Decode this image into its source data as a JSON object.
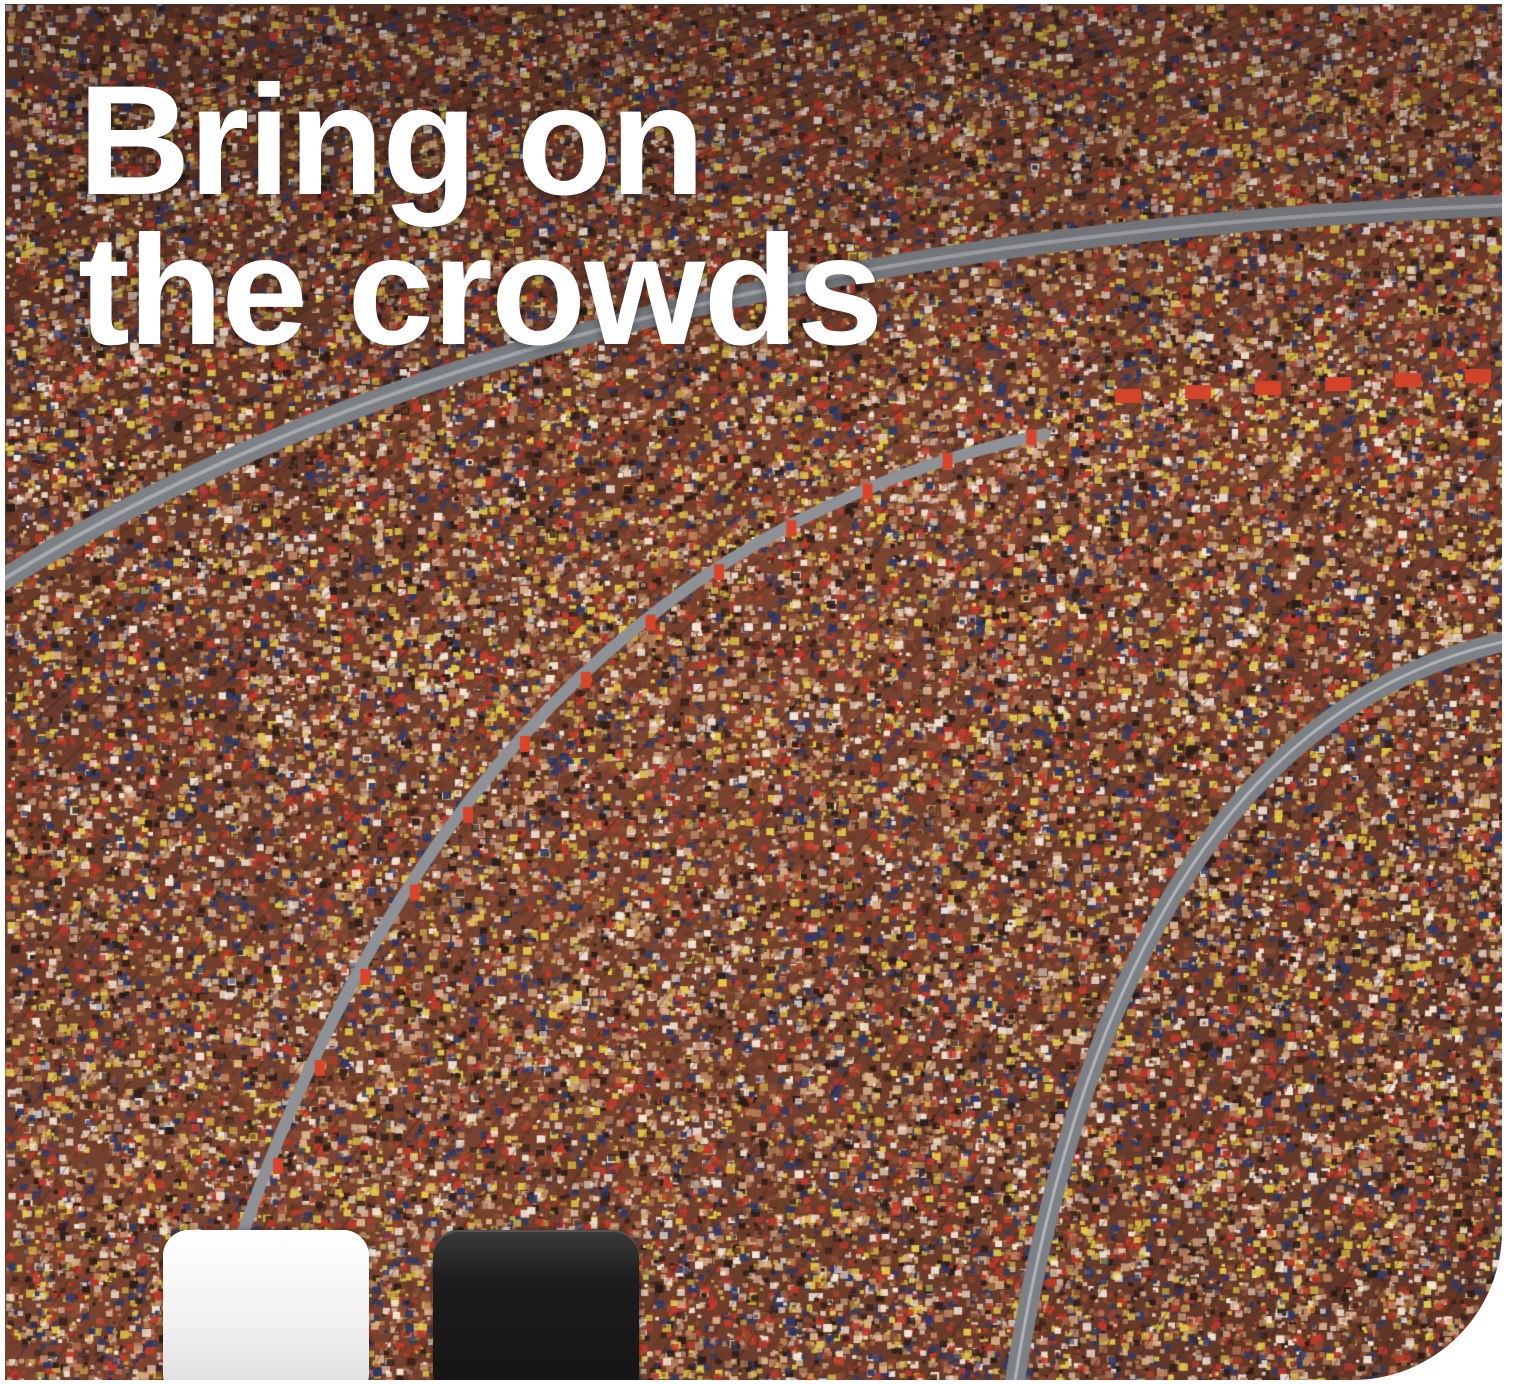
{
  "headline": {
    "line1": "Bring on",
    "line2": "the crowds"
  },
  "photo": {
    "subject": "stadium-crowd",
    "palette": [
      "#6b3b25",
      "#8a4e33",
      "#b9825c",
      "#d9b08a",
      "#2c3a6b",
      "#c23a2a",
      "#e2c94a",
      "#f3e7d8",
      "#2a1d18"
    ],
    "tier_color": "#7d8186",
    "barrier_accent": "#d8452a"
  },
  "devices": [
    {
      "name": "white-device",
      "color": "#f4f4f4"
    },
    {
      "name": "black-device",
      "color": "#1a1a1a"
    }
  ]
}
